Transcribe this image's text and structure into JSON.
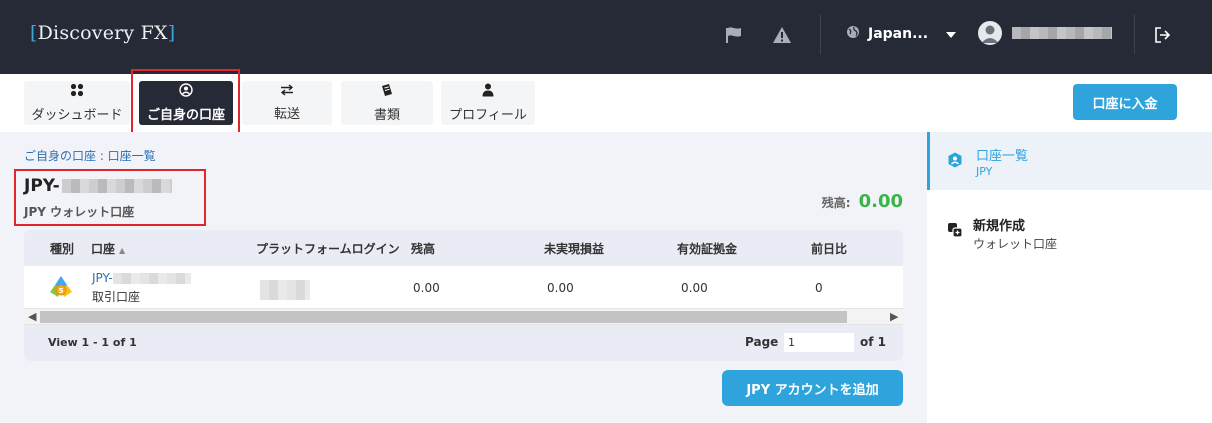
{
  "header": {
    "logo_text": "Discovery FX",
    "language": "Japan...",
    "icons": [
      "flag-icon",
      "warning-icon",
      "globe-icon",
      "chevron-down-icon",
      "user-icon",
      "logout-icon"
    ]
  },
  "nav": {
    "tabs": [
      {
        "label": "ダッシュボード",
        "icon": "grid-icon"
      },
      {
        "label": "ご自身の口座",
        "icon": "user-circle-icon",
        "active": true
      },
      {
        "label": "転送",
        "icon": "transfer-icon"
      },
      {
        "label": "書類",
        "icon": "document-icon"
      },
      {
        "label": "プロフィール",
        "icon": "person-icon"
      }
    ],
    "deposit_label": "口座に入金"
  },
  "main": {
    "breadcrumb": "ご自身の口座 : 口座一覧",
    "account_prefix": "JPY-",
    "account_subtitle": "JPY ウォレット口座",
    "balance_label": "残高:",
    "balance_value": "0.00",
    "table": {
      "columns": [
        "種別",
        "口座",
        "プラットフォームログイン",
        "残高",
        "未実現損益",
        "有効証拠金",
        "前日比"
      ],
      "rows": [
        {
          "account_prefix": "JPY-",
          "account_type": "取引口座",
          "balance": "0.00",
          "unrealized": "0.00",
          "equity": "0.00",
          "change": "0"
        }
      ],
      "footer_view": "View 1 - 1 of 1",
      "page_label": "Page",
      "page_value": "1",
      "page_of": "of 1"
    },
    "add_button_label": "JPY アカウントを追加"
  },
  "side": {
    "items": [
      {
        "title": "口座一覧",
        "subtitle": "JPY",
        "icon": "account-icon",
        "active": true
      },
      {
        "title": "新規作成",
        "subtitle": "ウォレット口座",
        "icon": "new-wallet-icon"
      }
    ]
  },
  "colors": {
    "header_bg": "#262a37",
    "accent": "#2ea3dc",
    "balance_green": "#3cb34a",
    "highlight_red": "#e0262a"
  }
}
